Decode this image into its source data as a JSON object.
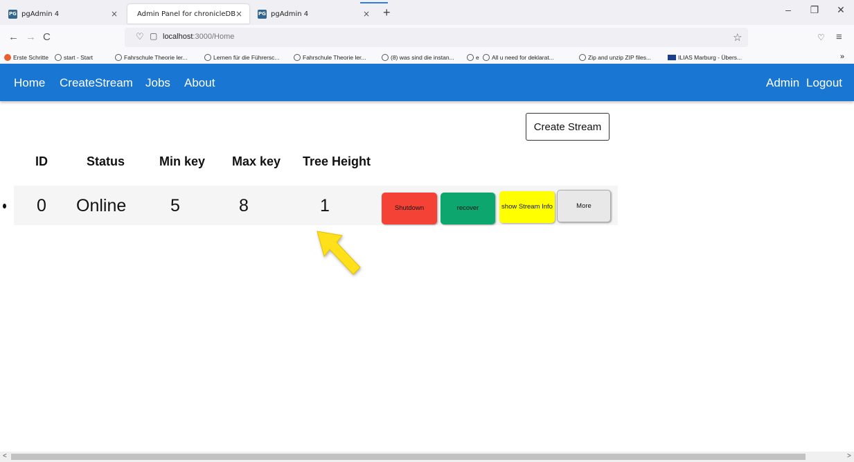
{
  "browser": {
    "tabs": [
      {
        "title": "pgAdmin 4",
        "icon": "PG"
      },
      {
        "title": "Admin Panel for chronicleDB"
      },
      {
        "title": "pgAdmin 4",
        "icon": "PG"
      }
    ],
    "new_tab": "+",
    "window_controls": [
      "–",
      "❐",
      "✕"
    ],
    "nav": {
      "back": "←",
      "forward": "→",
      "reload": "C"
    },
    "url_host": "localhost",
    "url_rest": ":3000/Home",
    "bookmarks": [
      "Erste Schritte",
      "start - Start",
      "Fahrschule Theorie ler...",
      "Lernen für die Führersc...",
      "Fahrschule Theorie ler...",
      "(8) was sind die instan...",
      "e",
      "All u need for deklarat...",
      "Zip and unzip ZIP files...",
      "ILIAS Marburg - Übers..."
    ],
    "bookmarks_overflow": "»"
  },
  "app_nav": {
    "links": [
      "Home",
      "CreateStream",
      "Jobs",
      "About"
    ],
    "right_links": [
      "Admin",
      "Logout"
    ],
    "color": "#1976d2"
  },
  "content": {
    "create_button": "Create Stream",
    "headers": [
      "ID",
      "Status",
      "Min key",
      "Max key",
      "Tree Height"
    ],
    "rows": [
      {
        "id": "0",
        "status": "Online",
        "min_key": "5",
        "max_key": "8",
        "tree_height": "1"
      }
    ],
    "actions": [
      {
        "label": "Shutdown",
        "color": "#f44336"
      },
      {
        "label": "recover",
        "color": "#0da66e"
      },
      {
        "label": "show Stream Info",
        "color": "#ffff00"
      },
      {
        "label": "More",
        "color": "#e8e8e8"
      }
    ]
  }
}
